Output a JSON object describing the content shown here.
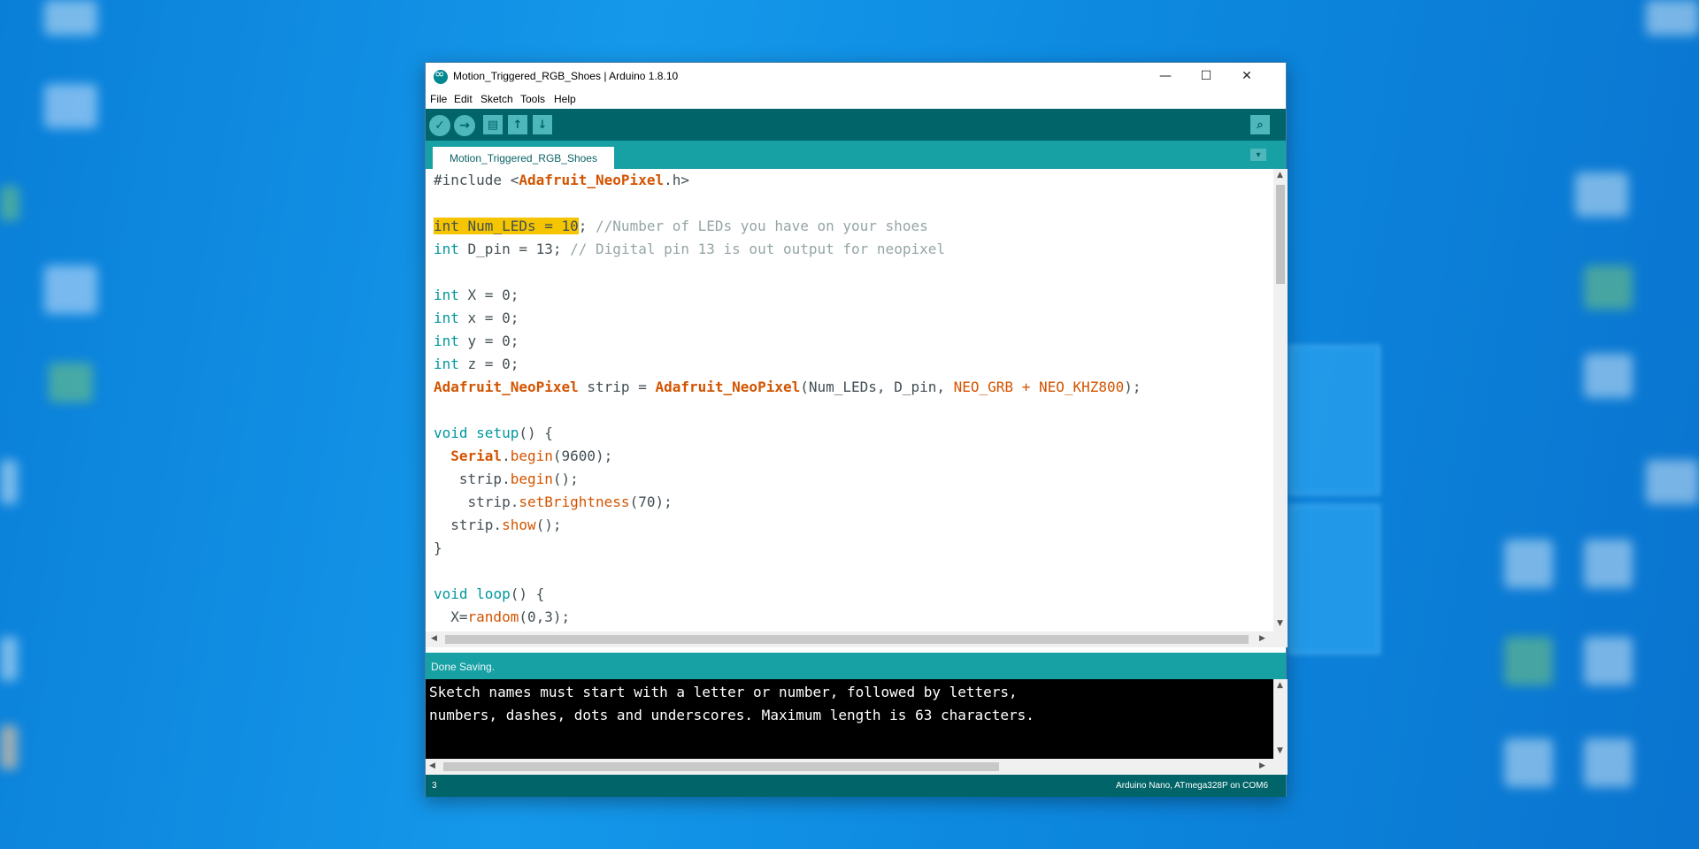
{
  "window": {
    "title": "Motion_Triggered_RGB_Shoes | Arduino 1.8.10",
    "minimize": "—",
    "maximize": "☐",
    "close": "✕"
  },
  "menu": {
    "file": "File",
    "edit": "Edit",
    "sketch": "Sketch",
    "tools": "Tools",
    "help": "Help"
  },
  "toolbar": {
    "verify": "✓",
    "upload": "→",
    "new": "▤",
    "open": "↑",
    "save": "↓",
    "serial_monitor": "⌕"
  },
  "tab": {
    "label": "Motion_Triggered_RGB_Shoes",
    "menu": "▾"
  },
  "code": {
    "l1": {
      "a": "#include <",
      "b": "Adafruit_NeoPixel",
      "c": ".h>"
    },
    "l3": {
      "hl_kw": "int",
      "hl_rest": " Num_LEDs = 10",
      "rest": "; ",
      "comment": "//Number of LEDs you have on your shoes"
    },
    "l4": {
      "kw": "int",
      "rest": " D_pin = 13; ",
      "comment": "// Digital pin 13 is out output for neopixel"
    },
    "l6": {
      "kw": "int",
      "rest": " X = 0;"
    },
    "l7": {
      "kw": "int",
      "rest": " x = 0;"
    },
    "l8": {
      "kw": "int",
      "rest": " y = 0;"
    },
    "l9": {
      "kw": "int",
      "rest": " z = 0;"
    },
    "l10": {
      "cls1": "Adafruit_NeoPixel",
      "a": " strip = ",
      "cls2": "Adafruit_NeoPixel",
      "b": "(Num_LEDs, D_pin, ",
      "c1": "NEO_GRB",
      "d": " + ",
      "c2": "NEO_KHZ800",
      "e": ");"
    },
    "l12": {
      "kw": "void",
      "sp": " ",
      "fn": "setup",
      "rest": "() {"
    },
    "l13": {
      "indent": "  ",
      "cls": "Serial",
      "dot": ".",
      "fn": "begin",
      "rest": "(9600);"
    },
    "l14": {
      "indent": "   strip.",
      "fn": "begin",
      "rest": "();"
    },
    "l15": {
      "indent": "    strip.",
      "fn": "setBrightness",
      "rest": "(70);"
    },
    "l16": {
      "indent": "  strip.",
      "fn": "show",
      "rest": "();"
    },
    "l17": {
      "text": "}"
    },
    "l19": {
      "kw": "void",
      "sp": " ",
      "fn": "loop",
      "rest": "() {"
    },
    "l20": {
      "indent": "  X=",
      "fn": "random",
      "rest": "(0,3);"
    }
  },
  "status": {
    "message": "Done Saving."
  },
  "console": {
    "line1": "Sketch names must start with a letter or number, followed by letters,",
    "line2": "numbers, dashes, dots and underscores. Maximum length is 63 characters."
  },
  "footer": {
    "line_number": "3",
    "board": "Arduino Nano, ATmega328P on COM6"
  },
  "colors": {
    "toolbar": "#006468",
    "tabbar": "#17a1a5",
    "keyword": "#00979c",
    "class": "#d35400",
    "comment": "#95a5a6",
    "highlight": "#f4c500"
  }
}
